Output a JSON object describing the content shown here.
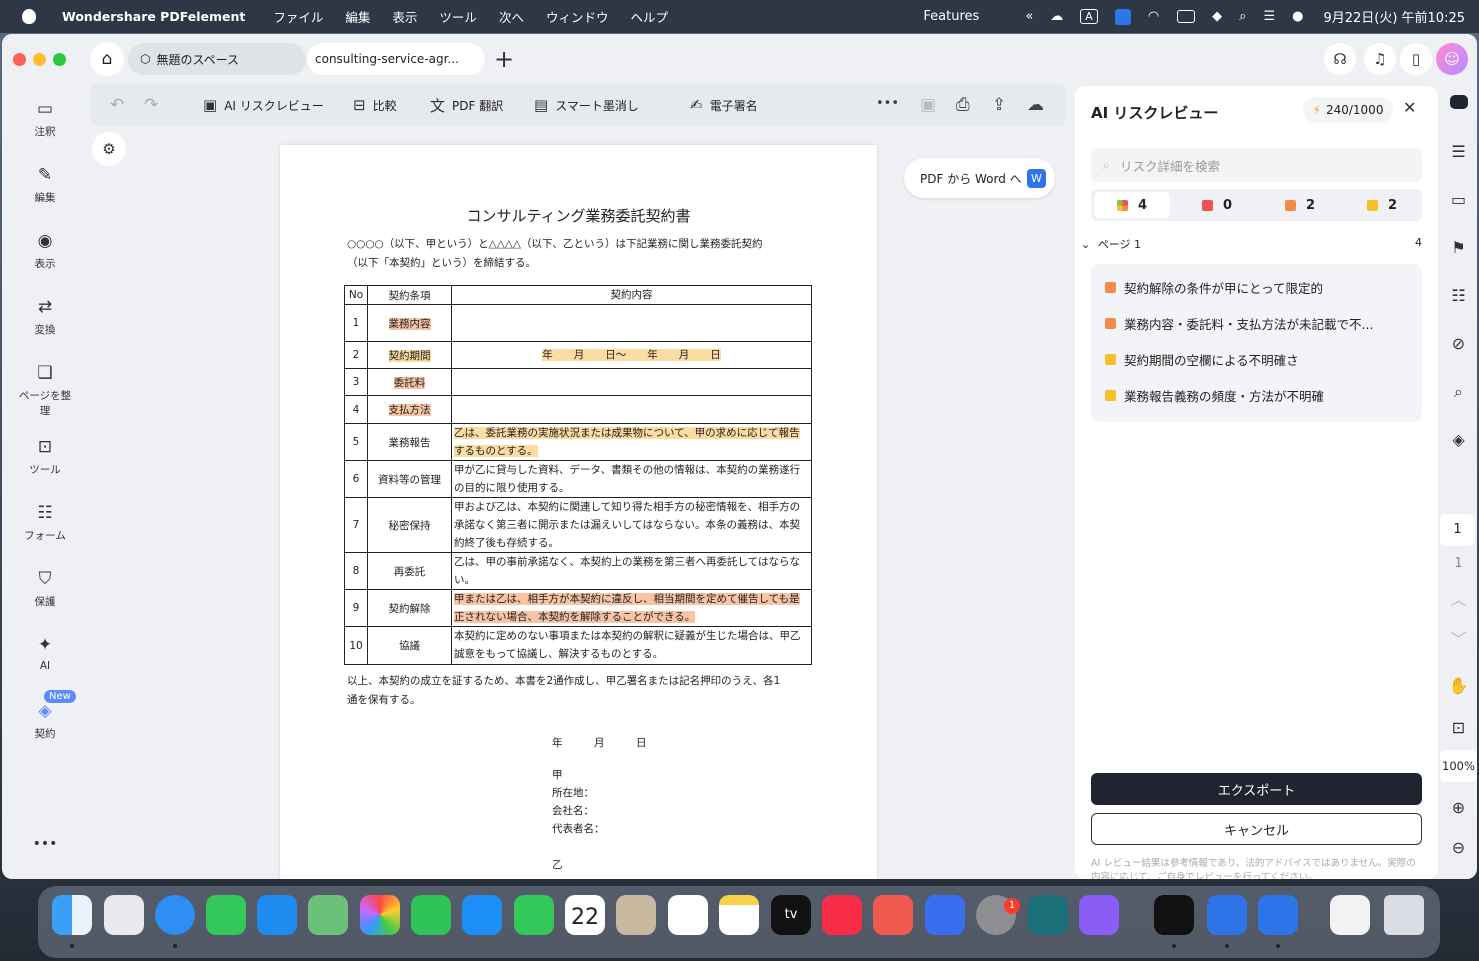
{
  "menubar": {
    "app_name": "Wondershare PDFelement",
    "menus": [
      "ファイル",
      "編集",
      "表示",
      "ツール",
      "次へ",
      "ウィンドウ",
      "ヘルプ"
    ],
    "features": "Features",
    "input_mode": "A",
    "datetime": "9月22日(火) 午前10:25"
  },
  "tabs": {
    "space": "無題のスペース",
    "document": "consulting-service-agr..."
  },
  "leftbar": {
    "items": [
      {
        "label": "注釈",
        "icon": "comment-icon"
      },
      {
        "label": "編集",
        "icon": "edit-icon"
      },
      {
        "label": "表示",
        "icon": "view-icon"
      },
      {
        "label": "変換",
        "icon": "convert-icon"
      },
      {
        "label": "ページを整理",
        "icon": "organize-pages-icon"
      },
      {
        "label": "ツール",
        "icon": "tools-icon"
      },
      {
        "label": "フォーム",
        "icon": "form-icon"
      },
      {
        "label": "保護",
        "icon": "shield-icon"
      },
      {
        "label": "AI",
        "icon": "magic-wand-icon"
      },
      {
        "label": "契約",
        "icon": "contract-icon"
      }
    ],
    "new_badge": "New",
    "more": "•••"
  },
  "toolbar": {
    "ai_risk": "AI リスクレビュー",
    "compare": "比較",
    "translate": "PDF 翻訳",
    "redact": "スマート墨消し",
    "esign": "電子署名",
    "more": "•••"
  },
  "pdf_to_word": "PDF から Word へ",
  "document": {
    "title": "コンサルティング業務委託契約書",
    "intro_1": "○○○○（以下、甲という）と△△△△（以下、乙という）は下記業務に関し業務委託契約",
    "intro_2": "（以下「本契約」という）を締結する。",
    "table_header": {
      "no": "No",
      "clause": "契約条項",
      "content": "契約内容"
    },
    "rows": [
      {
        "no": "1",
        "clause": "業務内容",
        "content": ""
      },
      {
        "no": "2",
        "clause": "契約期間",
        "content": "年　　月　　日〜　　年　　月　　日"
      },
      {
        "no": "3",
        "clause": "委託料",
        "content": ""
      },
      {
        "no": "4",
        "clause": "支払方法",
        "content": ""
      },
      {
        "no": "5",
        "clause": "業務報告",
        "content": "乙は、委託業務の実施状況または成果物について、甲の求めに応じて報告するものとする。"
      },
      {
        "no": "6",
        "clause": "資料等の管理",
        "content": "甲が乙に貸与した資料、データ、書類その他の情報は、本契約の業務遂行の目的に限り使用する。"
      },
      {
        "no": "7",
        "clause": "秘密保持",
        "content": "甲および乙は、本契約に関連して知り得た相手方の秘密情報を、相手方の承諾なく第三者に開示または漏えいしてはならない。本条の義務は、本契約終了後も存続する。"
      },
      {
        "no": "8",
        "clause": "再委託",
        "content": "乙は、甲の事前承諾なく、本契約上の業務を第三者へ再委託してはならない。"
      },
      {
        "no": "9",
        "clause": "契約解除",
        "content": "甲または乙は、相手方が本契約に違反し、相当期間を定めて催告しても是正されない場合、本契約を解除することができる。"
      },
      {
        "no": "10",
        "clause": "協議",
        "content": "本契約に定めのない事項または本契約の解釈に疑義が生じた場合は、甲乙誠意をもって協議し、解決するものとする。"
      }
    ],
    "closing_1": "以上、本契約の成立を証するため、本書を2通作成し、甲乙署名または記名押印のうえ、各1",
    "closing_2": "通を保有する。",
    "date_line": "年　　　月　　　日",
    "party_a": "甲",
    "address": "所在地：",
    "company": "会社名：",
    "representative": "代表者名：",
    "party_b": "乙"
  },
  "panel": {
    "title": "AI リスクレビュー",
    "credits": "240/1000",
    "search_placeholder": "リスク詳細を検索",
    "filters": [
      {
        "count": "4",
        "color": "multi"
      },
      {
        "count": "0",
        "color": "#ef5350"
      },
      {
        "count": "2",
        "color": "#f5894a"
      },
      {
        "count": "2",
        "color": "#f7c02a"
      }
    ],
    "page_label": "ページ 1",
    "page_count": "4",
    "risks": [
      {
        "text": "契約解除の条件が甲にとって限定的",
        "color": "#f5894a"
      },
      {
        "text": "業務内容・委託料・支払方法が未記載で不...",
        "color": "#f5894a"
      },
      {
        "text": "契約期間の空欄による不明確さ",
        "color": "#f7c02a"
      },
      {
        "text": "業務報告義務の頻度・方法が不明確",
        "color": "#f7c02a"
      }
    ],
    "export": "エクスポート",
    "cancel": "キャンセル",
    "disclaimer": "AI レビュー結果は参考情報であり、法的アドバイスではありません。実際の内容に応じて、ご自身でレビューを行ってください。"
  },
  "rightrail": {
    "current_page": "1",
    "total_pages": "1",
    "zoom": "100%"
  },
  "dock": {
    "calendar_date": "22",
    "settings_badge": "1",
    "appletv": "tv"
  }
}
